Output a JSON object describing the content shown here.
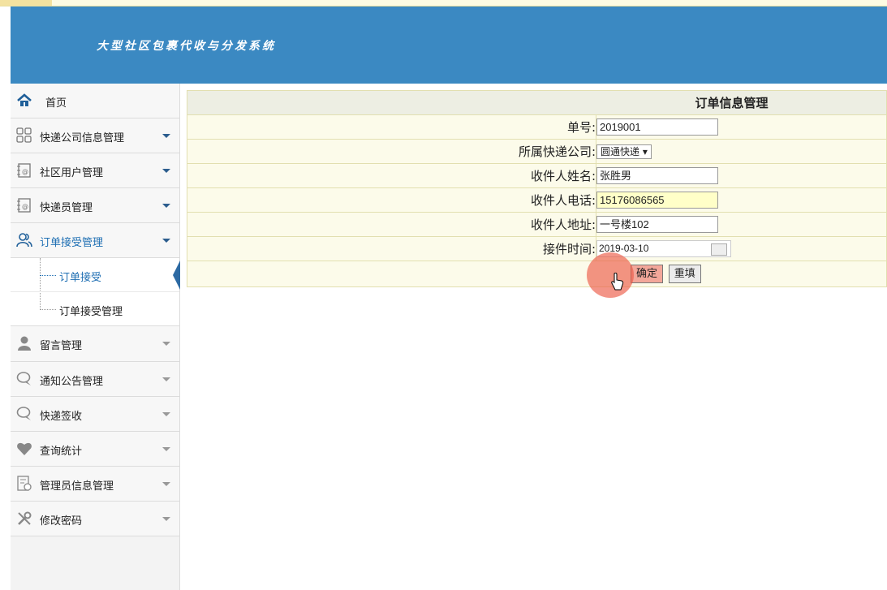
{
  "app": {
    "title": "大型社区包裹代收与分发系统"
  },
  "sidebar": {
    "items": [
      {
        "label": "首页",
        "icon": "home-icon"
      },
      {
        "label": "快递公司信息管理",
        "icon": "grid-icon"
      },
      {
        "label": "社区用户管理",
        "icon": "contact-book-icon"
      },
      {
        "label": "快递员管理",
        "icon": "contact-book-icon"
      },
      {
        "label": "订单接受管理",
        "icon": "users-icon"
      },
      {
        "label": "留言管理",
        "icon": "user-icon"
      },
      {
        "label": "通知公告管理",
        "icon": "chat-icon"
      },
      {
        "label": "快递签收",
        "icon": "chat-icon"
      },
      {
        "label": "查询统计",
        "icon": "heart-icon"
      },
      {
        "label": "管理员信息管理",
        "icon": "admin-doc-icon"
      },
      {
        "label": "修改密码",
        "icon": "tools-icon"
      }
    ],
    "submenu": [
      {
        "label": "订单接受"
      },
      {
        "label": "订单接受管理"
      }
    ]
  },
  "form": {
    "title": "订单信息管理",
    "fields": {
      "order_no": {
        "label": "单号:",
        "value": "2019001"
      },
      "company": {
        "label": "所属快递公司:",
        "value": "圆通快递"
      },
      "name": {
        "label": "收件人姓名:",
        "value": "张胜男"
      },
      "phone": {
        "label": "收件人电话:",
        "value": "15176086565"
      },
      "address": {
        "label": "收件人地址:",
        "value": "一号楼102"
      },
      "time": {
        "label": "接件时间:",
        "value": "2019-03-10"
      }
    },
    "confirm_label": "确定",
    "reset_label": "重填"
  },
  "colors": {
    "header": "#3b89c2",
    "accent": "#1f6fb3",
    "click_marker": "#ec5a46"
  }
}
